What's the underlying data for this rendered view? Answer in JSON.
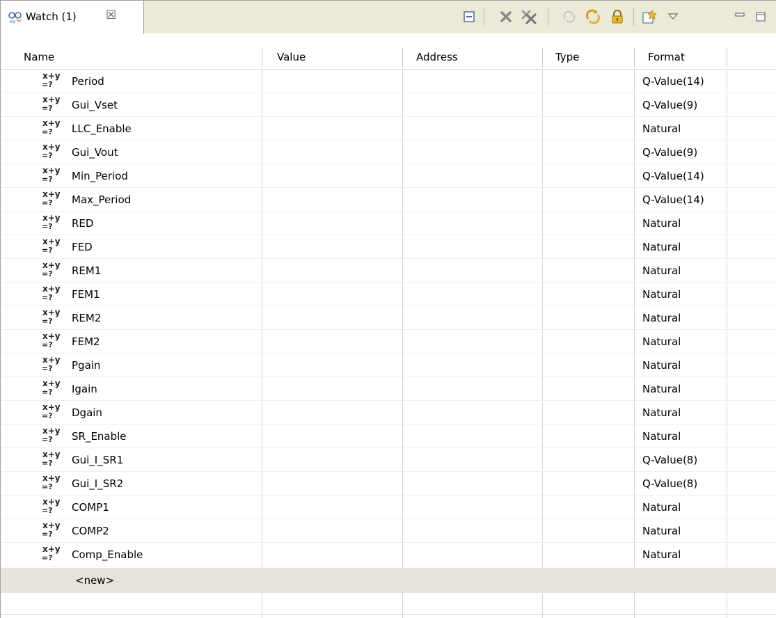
{
  "view": {
    "tab_title": "Watch (1)",
    "tab_close_glyph": "☒",
    "toolbar": [
      {
        "name": "collapse-all-icon"
      },
      {
        "name": "remove-icon"
      },
      {
        "name": "remove-all-icon"
      },
      {
        "name": "refresh-icon"
      },
      {
        "name": "continuous-refresh-icon"
      },
      {
        "name": "lock-icon"
      },
      {
        "name": "new-expression-icon"
      },
      {
        "name": "view-menu-icon"
      },
      {
        "name": "minimize-icon"
      },
      {
        "name": "maximize-icon"
      }
    ]
  },
  "table": {
    "columns": [
      "Name",
      "Value",
      "Address",
      "Type",
      "Format"
    ],
    "rows": [
      {
        "name": "Period",
        "value": "",
        "address": "",
        "type": "",
        "format": "Q-Value(14)"
      },
      {
        "name": "Gui_Vset",
        "value": "",
        "address": "",
        "type": "",
        "format": "Q-Value(9)"
      },
      {
        "name": "LLC_Enable",
        "value": "",
        "address": "",
        "type": "",
        "format": "Natural"
      },
      {
        "name": "Gui_Vout",
        "value": "",
        "address": "",
        "type": "",
        "format": "Q-Value(9)"
      },
      {
        "name": "Min_Period",
        "value": "",
        "address": "",
        "type": "",
        "format": "Q-Value(14)"
      },
      {
        "name": "Max_Period",
        "value": "",
        "address": "",
        "type": "",
        "format": "Q-Value(14)"
      },
      {
        "name": "RED",
        "value": "",
        "address": "",
        "type": "",
        "format": "Natural"
      },
      {
        "name": "FED",
        "value": "",
        "address": "",
        "type": "",
        "format": "Natural"
      },
      {
        "name": "REM1",
        "value": "",
        "address": "",
        "type": "",
        "format": "Natural"
      },
      {
        "name": "FEM1",
        "value": "",
        "address": "",
        "type": "",
        "format": "Natural"
      },
      {
        "name": "REM2",
        "value": "",
        "address": "",
        "type": "",
        "format": "Natural"
      },
      {
        "name": "FEM2",
        "value": "",
        "address": "",
        "type": "",
        "format": "Natural"
      },
      {
        "name": "Pgain",
        "value": "",
        "address": "",
        "type": "",
        "format": "Natural"
      },
      {
        "name": "Igain",
        "value": "",
        "address": "",
        "type": "",
        "format": "Natural"
      },
      {
        "name": "Dgain",
        "value": "",
        "address": "",
        "type": "",
        "format": "Natural"
      },
      {
        "name": "SR_Enable",
        "value": "",
        "address": "",
        "type": "",
        "format": "Natural"
      },
      {
        "name": "Gui_I_SR1",
        "value": "",
        "address": "",
        "type": "",
        "format": "Q-Value(8)"
      },
      {
        "name": "Gui_I_SR2",
        "value": "",
        "address": "",
        "type": "",
        "format": "Q-Value(8)"
      },
      {
        "name": "COMP1",
        "value": "",
        "address": "",
        "type": "",
        "format": "Natural"
      },
      {
        "name": "COMP2",
        "value": "",
        "address": "",
        "type": "",
        "format": "Natural"
      },
      {
        "name": "Comp_Enable",
        "value": "",
        "address": "",
        "type": "",
        "format": "Natural"
      }
    ],
    "new_row_label": "<new>"
  },
  "expression_icon_label": "x+y =?"
}
